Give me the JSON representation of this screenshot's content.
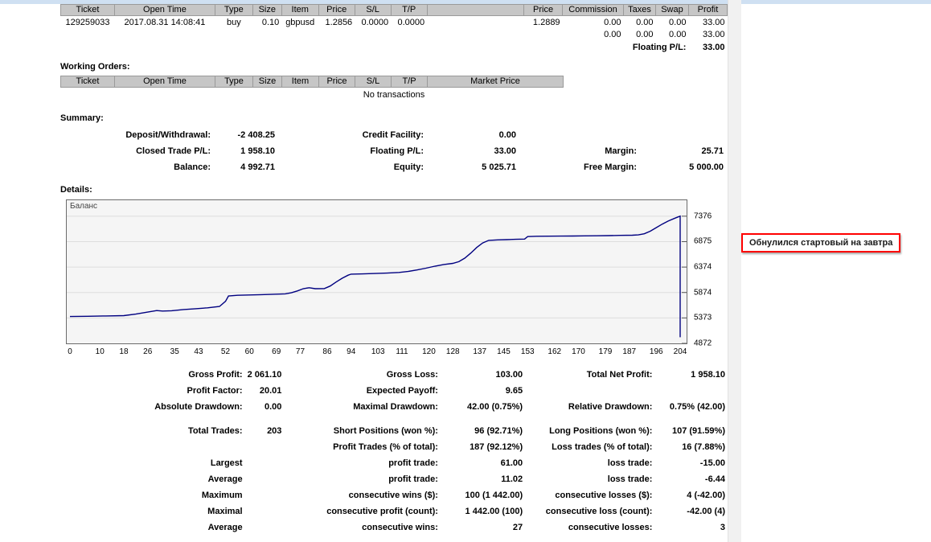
{
  "open_trades": {
    "headers": [
      "Ticket",
      "Open Time",
      "Type",
      "Size",
      "Item",
      "Price",
      "S/L",
      "T/P",
      "",
      "Price",
      "Commission",
      "Taxes",
      "Swap",
      "Profit"
    ],
    "row": [
      "129259033",
      "2017.08.31 14:08:41",
      "buy",
      "0.10",
      "gbpusd",
      "1.2856",
      "0.0000",
      "0.0000",
      "",
      "1.2889",
      "0.00",
      "0.00",
      "0.00",
      "33.00"
    ],
    "totals": [
      "0.00",
      "0.00",
      "0.00",
      "33.00"
    ],
    "floating_label": "Floating P/L:",
    "floating_value": "33.00"
  },
  "working_orders": {
    "title": "Working Orders:",
    "headers": [
      "Ticket",
      "Open Time",
      "Type",
      "Size",
      "Item",
      "Price",
      "S/L",
      "T/P",
      "Market Price"
    ],
    "empty_text": "No transactions"
  },
  "summary": {
    "title": "Summary:",
    "rows": [
      [
        "Deposit/Withdrawal:",
        "-2 408.25",
        "Credit Facility:",
        "0.00",
        "",
        ""
      ],
      [
        "Closed Trade P/L:",
        "1 958.10",
        "Floating P/L:",
        "33.00",
        "Margin:",
        "25.71"
      ],
      [
        "Balance:",
        "4 992.71",
        "Equity:",
        "5 025.71",
        "Free Margin:",
        "5 000.00"
      ]
    ]
  },
  "details": {
    "title": "Details:"
  },
  "chart_data": {
    "type": "line",
    "title": "Баланс",
    "xlabel": "",
    "ylabel": "",
    "xlim": [
      0,
      204
    ],
    "ylim": [
      4872,
      7690
    ],
    "grid": true,
    "legend_position": "none",
    "x_ticks": [
      0,
      10,
      18,
      26,
      35,
      43,
      52,
      60,
      69,
      77,
      86,
      94,
      103,
      111,
      120,
      128,
      137,
      145,
      153,
      162,
      170,
      179,
      187,
      196,
      204
    ],
    "y_ticks": [
      4872,
      5373,
      5874,
      6374,
      6875,
      7376
    ],
    "series": [
      {
        "name": "Баланс",
        "color": "#000080",
        "points": [
          [
            0,
            5400
          ],
          [
            6,
            5405
          ],
          [
            12,
            5412
          ],
          [
            18,
            5418
          ],
          [
            22,
            5448
          ],
          [
            26,
            5488
          ],
          [
            29,
            5518
          ],
          [
            31,
            5508
          ],
          [
            34,
            5515
          ],
          [
            38,
            5538
          ],
          [
            42,
            5555
          ],
          [
            46,
            5572
          ],
          [
            50,
            5598
          ],
          [
            52,
            5700
          ],
          [
            53,
            5805
          ],
          [
            56,
            5818
          ],
          [
            60,
            5825
          ],
          [
            64,
            5832
          ],
          [
            68,
            5840
          ],
          [
            72,
            5848
          ],
          [
            74,
            5868
          ],
          [
            76,
            5905
          ],
          [
            78,
            5948
          ],
          [
            80,
            5968
          ],
          [
            82,
            5948
          ],
          [
            85,
            5950
          ],
          [
            87,
            6000
          ],
          [
            89,
            6080
          ],
          [
            91,
            6155
          ],
          [
            93,
            6215
          ],
          [
            94,
            6235
          ],
          [
            98,
            6240
          ],
          [
            102,
            6248
          ],
          [
            106,
            6255
          ],
          [
            110,
            6268
          ],
          [
            113,
            6288
          ],
          [
            116,
            6318
          ],
          [
            119,
            6352
          ],
          [
            122,
            6392
          ],
          [
            125,
            6425
          ],
          [
            128,
            6448
          ],
          [
            130,
            6480
          ],
          [
            132,
            6550
          ],
          [
            134,
            6650
          ],
          [
            136,
            6760
          ],
          [
            138,
            6850
          ],
          [
            140,
            6900
          ],
          [
            143,
            6910
          ],
          [
            146,
            6915
          ],
          [
            149,
            6920
          ],
          [
            152,
            6925
          ],
          [
            153,
            6975
          ],
          [
            156,
            6980
          ],
          [
            160,
            6982
          ],
          [
            164,
            6984
          ],
          [
            168,
            6986
          ],
          [
            172,
            6988
          ],
          [
            176,
            6990
          ],
          [
            180,
            6994
          ],
          [
            184,
            6998
          ],
          [
            188,
            7002
          ],
          [
            190,
            7008
          ],
          [
            192,
            7030
          ],
          [
            194,
            7080
          ],
          [
            196,
            7150
          ],
          [
            198,
            7220
          ],
          [
            200,
            7280
          ],
          [
            202,
            7330
          ],
          [
            203,
            7355
          ],
          [
            204,
            7376
          ],
          [
            204,
            4993
          ]
        ]
      }
    ]
  },
  "stats": {
    "rows": [
      [
        "Gross Profit:",
        "2 061.10",
        "Gross Loss:",
        "103.00",
        "Total Net Profit:",
        "1 958.10"
      ],
      [
        "Profit Factor:",
        "20.01",
        "Expected Payoff:",
        "9.65",
        "",
        ""
      ],
      [
        "Absolute Drawdown:",
        "0.00",
        "Maximal Drawdown:",
        "42.00 (0.75%)",
        "Relative Drawdown:",
        "0.75% (42.00)"
      ],
      [
        "Total Trades:",
        "203",
        "Short Positions (won %):",
        "96 (92.71%)",
        "Long Positions (won %):",
        "107 (91.59%)"
      ],
      [
        "",
        "",
        "Profit Trades (% of total):",
        "187 (92.12%)",
        "Loss trades (% of total):",
        "16 (7.88%)"
      ],
      [
        "Largest",
        "",
        "profit trade:",
        "61.00",
        "loss trade:",
        "-15.00"
      ],
      [
        "Average",
        "",
        "profit trade:",
        "11.02",
        "loss trade:",
        "-6.44"
      ],
      [
        "Maximum",
        "",
        "consecutive wins ($):",
        "100 (1 442.00)",
        "consecutive losses ($):",
        "4 (-42.00)"
      ],
      [
        "Maximal",
        "",
        "consecutive profit (count):",
        "1 442.00 (100)",
        "consecutive loss (count):",
        "-42.00 (4)"
      ],
      [
        "Average",
        "",
        "consecutive wins:",
        "27",
        "consecutive losses:",
        "3"
      ]
    ]
  },
  "annotation": {
    "text": "Обнулился стартовый на завтра",
    "border_color": "#ff0000",
    "text_color": "#1a1a1a"
  },
  "colors": {
    "header_cell_bg": "#c6c6c6",
    "balance_line": "#000080",
    "chart_bg": "#f5f5f5",
    "top_strip": "#cfe0f2"
  }
}
